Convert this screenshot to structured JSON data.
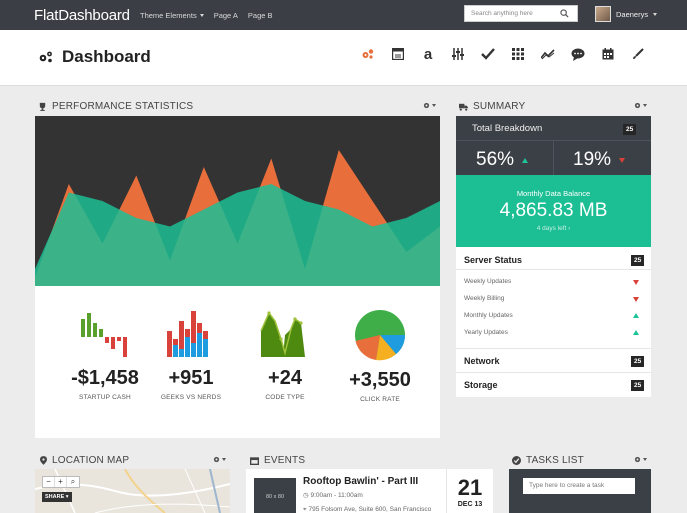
{
  "navbar": {
    "brand": "FlatDashboard",
    "items": [
      {
        "label": "Theme Elements",
        "has_caret": true
      },
      {
        "label": "Page A",
        "has_caret": false
      },
      {
        "label": "Page B",
        "has_caret": false
      }
    ],
    "search_placeholder": "Search anything here",
    "user_name": "Daenerys"
  },
  "header": {
    "title": "Dashboard",
    "toolbar_icons": [
      "gears-icon",
      "window-icon",
      "font-a-icon",
      "sliders-icon",
      "check-icon",
      "grid-icon",
      "line-chart-icon",
      "chat-icon",
      "calendar-icon",
      "brush-icon"
    ]
  },
  "performance": {
    "title": "PERFORMANCE STATISTICS",
    "stats": [
      {
        "value": "-$1,458",
        "label": "STARTUP CASH",
        "type": "bar-neg"
      },
      {
        "value": "+951",
        "label": "GEEKS VS NERDS",
        "type": "stacked-bars"
      },
      {
        "value": "+24",
        "label": "CODE TYPE",
        "type": "area"
      },
      {
        "value": "+3,550",
        "label": "CLICK RATE",
        "type": "pie"
      }
    ]
  },
  "summary": {
    "title": "SUMMARY",
    "breakdown_label": "Total Breakdown",
    "breakdown_badge": "25",
    "pct_up": "56%",
    "pct_down": "19%",
    "monthly_label": "Monthly Data Balance",
    "monthly_value": "4,865.83 MB",
    "monthly_sub": "4 days left",
    "server_status": {
      "label": "Server Status",
      "badge": "25",
      "items": [
        {
          "label": "Weekly Updates",
          "trend": "down"
        },
        {
          "label": "Weekly Billing",
          "trend": "down"
        },
        {
          "label": "Monthly Updates",
          "trend": "up"
        },
        {
          "label": "Yearly Updates",
          "trend": "up"
        }
      ]
    },
    "network": {
      "label": "Network",
      "badge": "25"
    },
    "storage": {
      "label": "Storage",
      "badge": "25"
    }
  },
  "location_map": {
    "title": "LOCATION MAP",
    "share_label": "SHARE"
  },
  "events": {
    "title": "EVENTS",
    "thumb_label": "80 x 80",
    "event_title": "Rooftop Bawlin' - Part III",
    "event_time": "9:00am - 11:00am",
    "event_address": "795 Folsom Ave, Suite 600, San Francisco",
    "day": "21",
    "month_year": "DEC 13"
  },
  "tasks": {
    "title": "TASKS LIST",
    "input_placeholder": "Type here to create a task"
  },
  "colors": {
    "green": "#1cbe94",
    "orange": "#e86e3c",
    "dark": "#3b4046",
    "red": "#d9423a",
    "blue": "#1f9be0"
  },
  "chart_data": {
    "type": "area",
    "title": "",
    "xlabel": "",
    "ylabel": "",
    "x": [
      0,
      1,
      2,
      3,
      4,
      5,
      6,
      7,
      8,
      9,
      10,
      11,
      12
    ],
    "ylim": [
      0,
      100
    ],
    "grid": false,
    "legend": "none",
    "series": [
      {
        "color": "#e86e3c",
        "values": [
          5,
          60,
          25,
          65,
          15,
          70,
          25,
          75,
          10,
          80,
          50,
          20,
          35
        ]
      },
      {
        "color": "#1cbe94",
        "values": [
          10,
          55,
          50,
          40,
          35,
          45,
          55,
          60,
          50,
          45,
          35,
          40,
          50
        ]
      }
    ]
  }
}
